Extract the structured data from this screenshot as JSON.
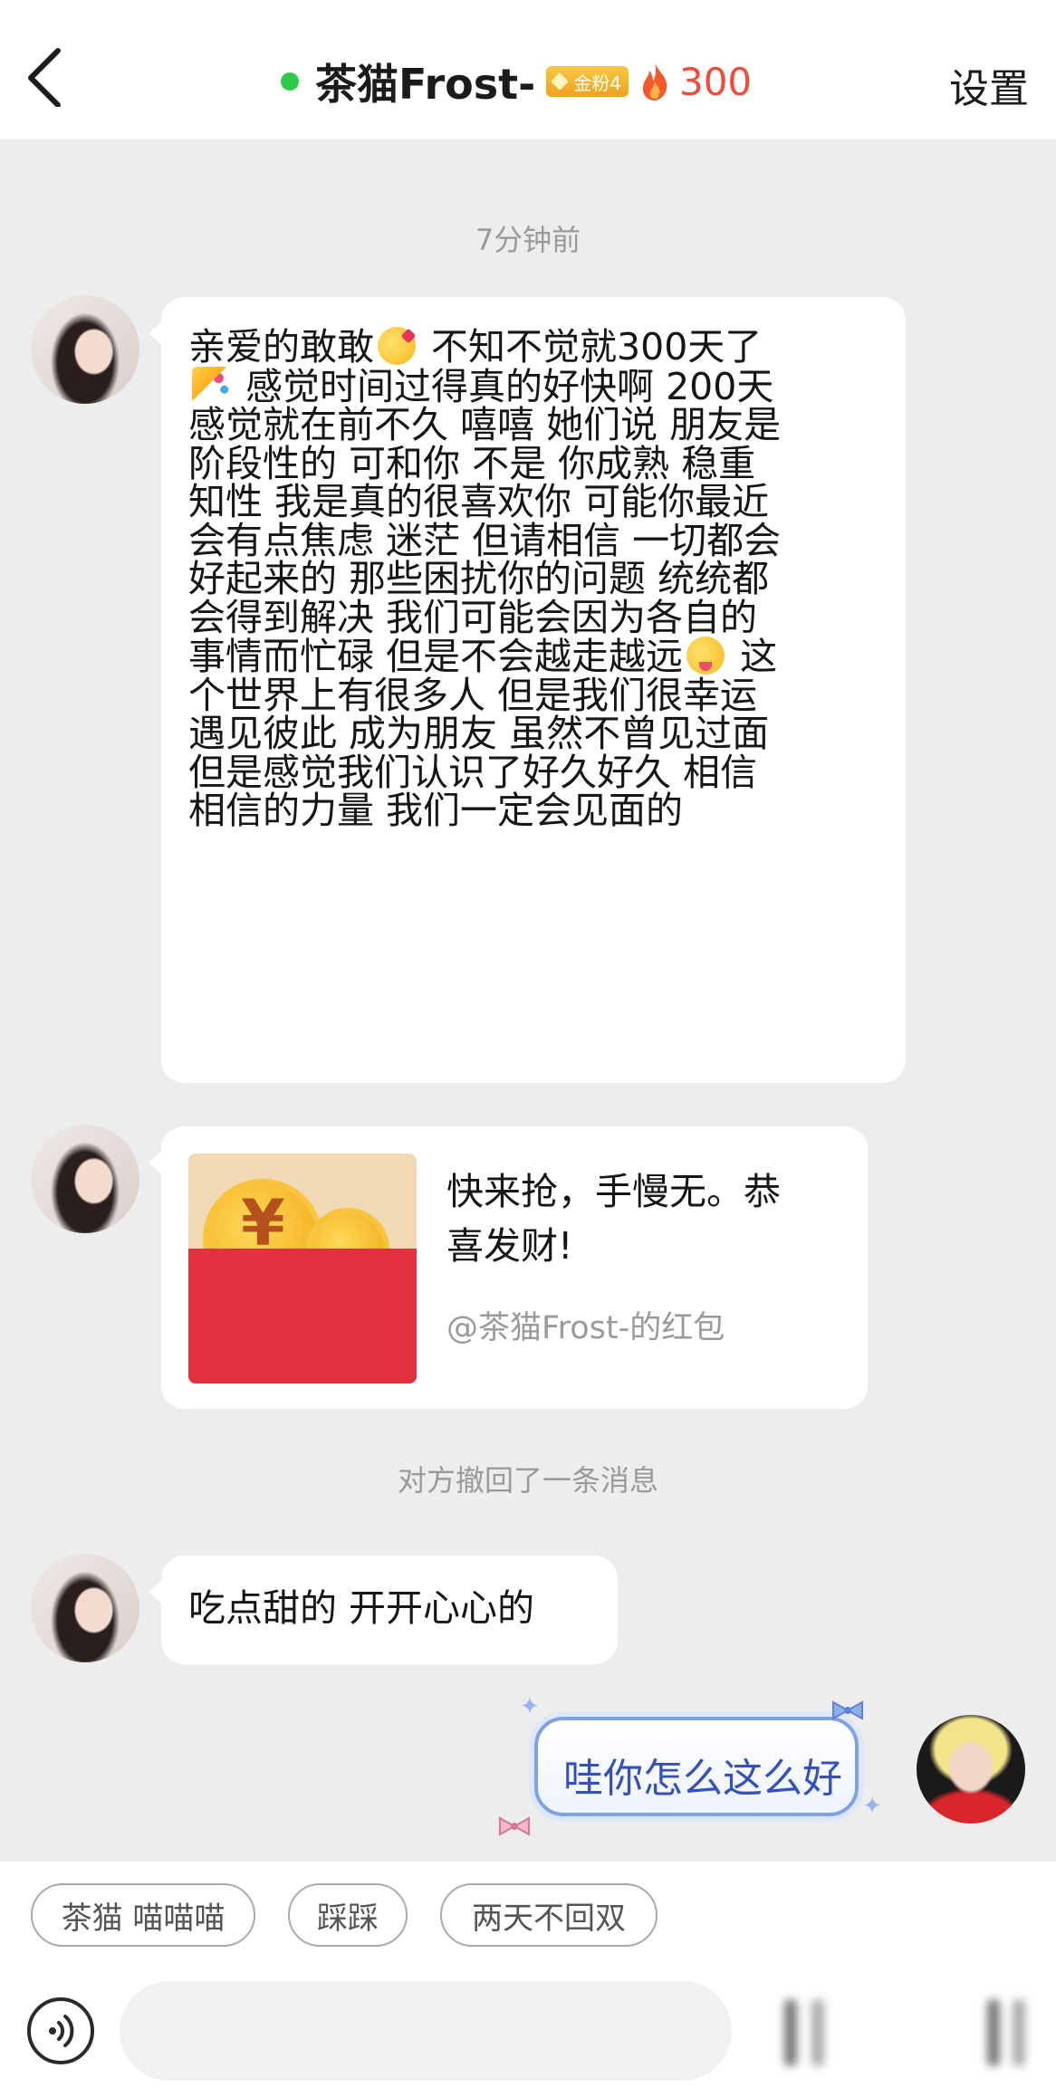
{
  "header": {
    "title": "茶猫Frost-",
    "fan_badge": "金粉4",
    "heat_value": "300",
    "settings_label": "设置"
  },
  "timestamp": "7分钟前",
  "messages": {
    "long_text_lines": [
      "亲爱的敢敢",
      "不知不觉就300天了",
      "感觉时间过得真的好快啊 200天",
      "感觉就在前不久 嘻嘻 她们说 朋友是",
      "阶段性的 可和你 不是 你成熟 稳重",
      "知性 我是真的很喜欢你 可能你最近",
      "会有点焦虑 迷茫 但请相信 一切都会",
      "好起来的 那些困扰你的问题 统统都",
      "会得到解决 我们可能会因为各自的",
      "事情而忙碌 但是不会越走越远",
      "这",
      "个世界上有很多人 但是我们很幸运",
      "遇见彼此 成为朋友 虽然不曾见过面",
      "但是感觉我们认识了好久好久 相信",
      "相信的力量 我们一定会见面的"
    ],
    "red_packet": {
      "symbol": "¥",
      "line1": "快来抢，手慢无。恭",
      "line2": "喜发财!",
      "sender": "@茶猫Frost-的红包"
    },
    "recall_notice": "对方撤回了一条消息",
    "sweet_text": "吃点甜的 开开心心的",
    "my_reply": "哇你怎么这么好"
  },
  "quick_replies": [
    "茶猫 喵喵喵",
    "踩踩",
    "两天不回双"
  ],
  "input": {
    "placeholder": ""
  },
  "colors": {
    "background": "#ededed",
    "online": "#2ecb4a",
    "heat": "#f24a3b",
    "red_packet": "#e2313f",
    "my_bubble_border": "#7fa1e8"
  }
}
